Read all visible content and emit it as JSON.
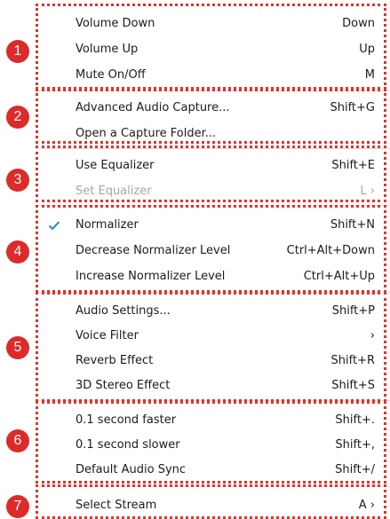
{
  "badge_color": "#dd2a2a",
  "highlight_color": "#e0322c",
  "groups": [
    {
      "badge": "1",
      "items": [
        {
          "label": "Volume Down",
          "shortcut": "Down"
        },
        {
          "label": "Volume Up",
          "shortcut": "Up"
        },
        {
          "label": "Mute On/Off",
          "shortcut": "M"
        }
      ]
    },
    {
      "badge": "2",
      "items": [
        {
          "label": "Advanced Audio Capture...",
          "shortcut": "Shift+G"
        },
        {
          "label": "Open a Capture Folder...",
          "shortcut": ""
        }
      ]
    },
    {
      "badge": "3",
      "items": [
        {
          "label": "Use Equalizer",
          "shortcut": "Shift+E"
        },
        {
          "label": "Set Equalizer",
          "shortcut": "L ›",
          "disabled": true
        }
      ]
    },
    {
      "badge": "4",
      "items": [
        {
          "label": "Normalizer",
          "shortcut": "Shift+N",
          "checked": true
        },
        {
          "label": "Decrease Normalizer Level",
          "shortcut": "Ctrl+Alt+Down"
        },
        {
          "label": "Increase Normalizer Level",
          "shortcut": "Ctrl+Alt+Up"
        }
      ]
    },
    {
      "badge": "5",
      "items": [
        {
          "label": "Audio Settings...",
          "shortcut": "Shift+P"
        },
        {
          "label": "Voice Filter",
          "shortcut": "›"
        },
        {
          "label": "Reverb Effect",
          "shortcut": "Shift+R"
        },
        {
          "label": "3D Stereo Effect",
          "shortcut": "Shift+S"
        }
      ]
    },
    {
      "badge": "6",
      "items": [
        {
          "label": "0.1 second faster",
          "shortcut": "Shift+."
        },
        {
          "label": "0.1 second slower",
          "shortcut": "Shift+,"
        },
        {
          "label": "Default Audio Sync",
          "shortcut": "Shift+/"
        }
      ]
    },
    {
      "badge": "7",
      "items": [
        {
          "label": "Select Stream",
          "shortcut": "A ›"
        }
      ]
    }
  ]
}
